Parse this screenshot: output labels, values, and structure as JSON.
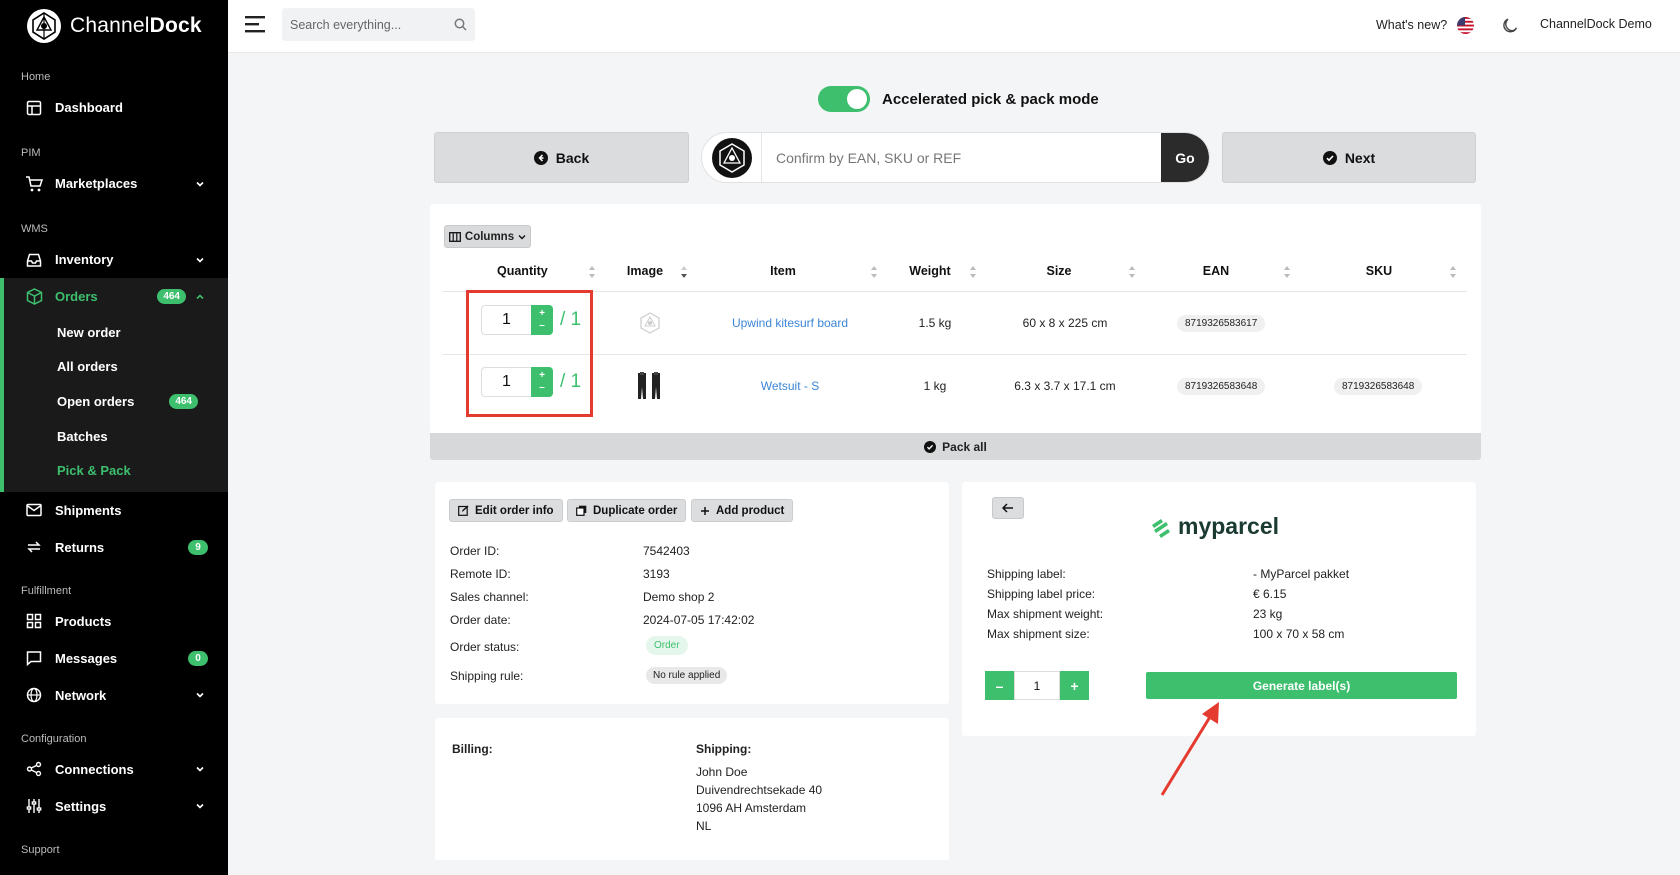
{
  "brand": {
    "name_light": "Channel",
    "name_bold": "Dock"
  },
  "sidebar": {
    "sections": {
      "home": "Home",
      "pim": "PIM",
      "wms": "WMS",
      "fulfillment": "Fulfillment",
      "configuration": "Configuration",
      "support": "Support"
    },
    "items": {
      "dashboard": "Dashboard",
      "marketplaces": "Marketplaces",
      "inventory": "Inventory",
      "orders": "Orders",
      "orders_badge": "464",
      "shipments": "Shipments",
      "returns": "Returns",
      "returns_badge": "9",
      "products": "Products",
      "messages": "Messages",
      "messages_badge": "0",
      "network": "Network",
      "connections": "Connections",
      "settings": "Settings"
    },
    "orders_sub": {
      "new_order": "New order",
      "all_orders": "All orders",
      "open_orders": "Open orders",
      "open_orders_badge": "464",
      "batches": "Batches",
      "pick_pack": "Pick & Pack"
    }
  },
  "topbar": {
    "search_placeholder": "Search everything...",
    "whats_new": "What's new?",
    "account": "ChannelDock Demo"
  },
  "mode": {
    "label": "Accelerated pick & pack mode",
    "enabled": true
  },
  "actions": {
    "back": "Back",
    "next": "Next",
    "confirm_placeholder": "Confirm by EAN, SKU or REF",
    "go": "Go"
  },
  "table": {
    "columns_btn": "Columns",
    "headers": [
      "Quantity",
      "Image",
      "Item",
      "Weight",
      "Size",
      "EAN",
      "SKU"
    ],
    "rows": [
      {
        "qty": "1",
        "total": "/ 1",
        "item": "Upwind kitesurf board",
        "weight": "1.5 kg",
        "size": "60 x 8 x 225 cm",
        "ean": "8719326583617",
        "sku": ""
      },
      {
        "qty": "1",
        "total": "/ 1",
        "item": "Wetsuit - S",
        "weight": "1 kg",
        "size": "6.3 x 3.7 x 17.1 cm",
        "ean": "8719326583648",
        "sku": "8719326583648"
      }
    ],
    "pack_all": "Pack all"
  },
  "order": {
    "buttons": {
      "edit": "Edit order info",
      "duplicate": "Duplicate order",
      "add_product": "Add product"
    },
    "labels": {
      "order_id": "Order ID:",
      "remote_id": "Remote ID:",
      "sales_channel": "Sales channel:",
      "order_date": "Order date:",
      "order_status": "Order status:",
      "shipping_rule": "Shipping rule:"
    },
    "values": {
      "order_id": "7542403",
      "remote_id": "3193",
      "sales_channel": "Demo shop 2",
      "order_date": "2024-07-05 17:42:02",
      "order_status": "Order",
      "shipping_rule": "No rule applied"
    }
  },
  "address": {
    "billing_label": "Billing:",
    "shipping_label": "Shipping:",
    "shipping_lines": [
      "John Doe",
      "Duivendrechtsekade 40",
      "1096 AH Amsterdam",
      "NL"
    ]
  },
  "carrier": {
    "name": "myparcel",
    "labels": {
      "shipping_label": "Shipping label:",
      "price": "Shipping label price:",
      "max_weight": "Max shipment weight:",
      "max_size": "Max shipment size:"
    },
    "values": {
      "shipping_label": "- MyParcel pakket",
      "price": "€ 6.15",
      "max_weight": "23 kg",
      "max_size": "100 x 70 x 58 cm"
    },
    "quantity": "1",
    "minus": "–",
    "plus": "+",
    "generate": "Generate label(s)"
  },
  "colors": {
    "accent": "#3dbf6e",
    "highlight": "#e53a2f",
    "link": "#3c85d6"
  }
}
